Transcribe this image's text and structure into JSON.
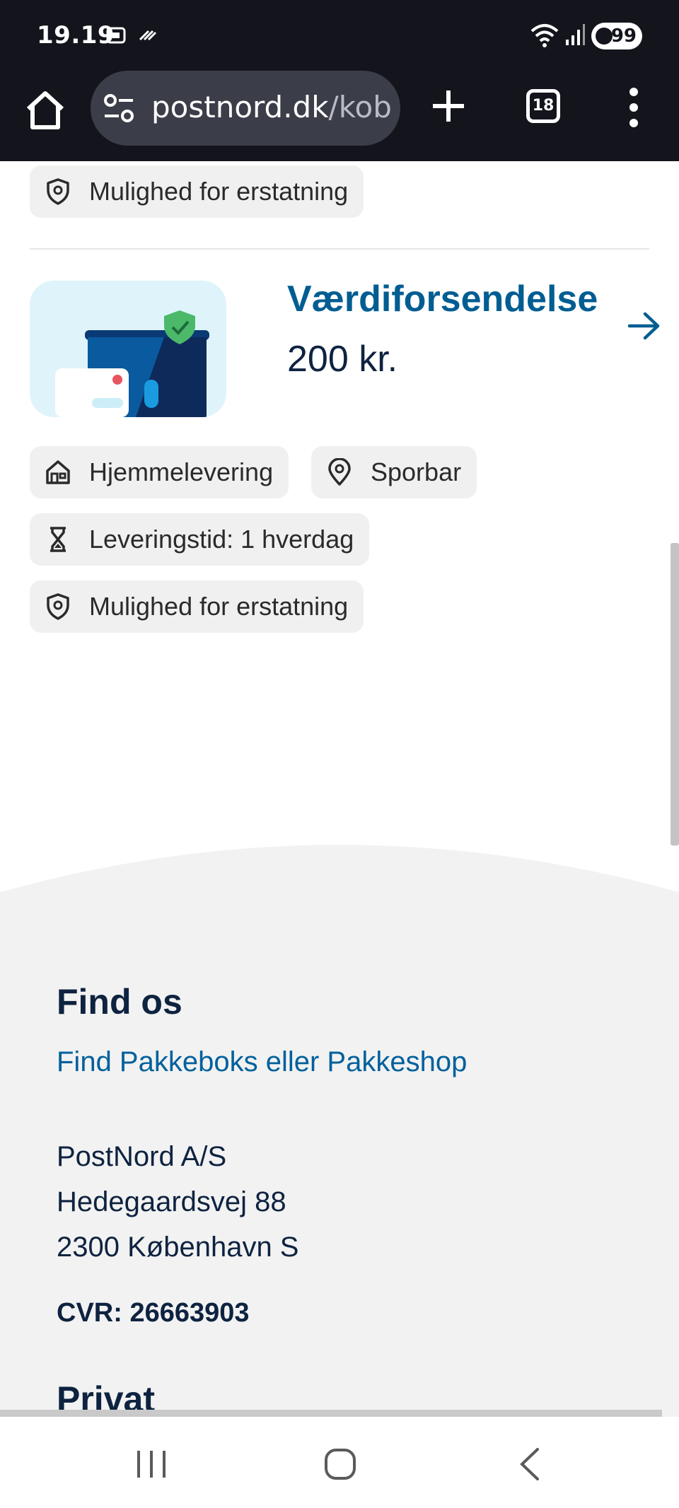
{
  "status_bar": {
    "time": "19.19",
    "battery": "99"
  },
  "browser": {
    "url_domain": "postnord.dk",
    "url_path": "/kob-",
    "tab_count": "18"
  },
  "product_above": {
    "chips": [
      "Mulighed for erstatning"
    ]
  },
  "product": {
    "title": "Værdiforsendelse",
    "price": "200 kr.",
    "chips": [
      "Hjemmelevering",
      "Sporbar",
      "Leveringstid: 1 hverdag",
      "Mulighed for erstatning"
    ],
    "chip_icons": [
      "home-icon",
      "location-pin-icon",
      "hourglass-icon",
      "shield-pin-icon"
    ]
  },
  "footer": {
    "find_title": "Find os",
    "find_link": "Find Pakkeboks eller Pakkeshop",
    "address": [
      "PostNord A/S",
      "Hedegaardsvej 88",
      "2300 København S"
    ],
    "cvr": "CVR: 26663903",
    "next_section": "Privat"
  },
  "colors": {
    "brand_blue": "#005d92",
    "dark_navy": "#0e2340",
    "footer_bg": "#f2f2f2",
    "chip_bg": "#f0f0f0"
  }
}
